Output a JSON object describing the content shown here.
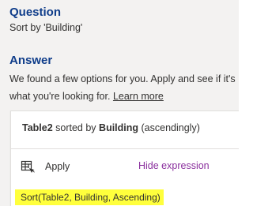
{
  "question": {
    "heading": "Question",
    "text": "Sort by 'Building'"
  },
  "answer": {
    "heading": "Answer",
    "line1": "We found a few options for you. Apply and see if it's",
    "line2_prefix": "what you're looking for. ",
    "learn_more": "Learn more"
  },
  "result_card": {
    "title": {
      "table": "Table2",
      "middle": " sorted by ",
      "column": "Building",
      "suffix": " (ascendingly)"
    },
    "apply_label": "Apply",
    "apply_icon": "table-apply-icon",
    "hide_expression_label": "Hide expression",
    "expression": "Sort(Table2, Building, Ascending)"
  },
  "colors": {
    "heading": "#0f3d8a",
    "hide_expression_link": "#8a2f9d",
    "highlight": "#ffff3c",
    "panel_background": "#f3f2f1"
  }
}
